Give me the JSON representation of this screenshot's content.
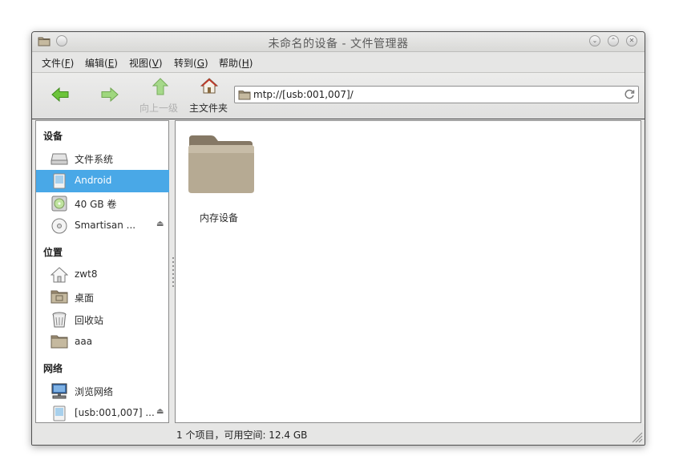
{
  "window": {
    "title": "未命名的设备 - 文件管理器",
    "controls": [
      "minimize-icon",
      "maximize-icon",
      "close-icon"
    ]
  },
  "menu": [
    {
      "label": "文件(",
      "key": "F",
      "tail": ")"
    },
    {
      "label": "编辑(",
      "key": "E",
      "tail": ")"
    },
    {
      "label": "视图(",
      "key": "V",
      "tail": ")"
    },
    {
      "label": "转到(",
      "key": "G",
      "tail": ")"
    },
    {
      "label": "帮助(",
      "key": "H",
      "tail": ")"
    }
  ],
  "toolbar": {
    "back_icon": "arrow-left-icon",
    "forward_icon": "arrow-right-icon",
    "up_label": "向上一级",
    "home_label": "主文件夹",
    "location": "mtp://[usb:001,007]/"
  },
  "sidebar": {
    "devices_header": "设备",
    "devices": [
      {
        "label": "文件系统",
        "icon": "drive-icon"
      },
      {
        "label": "Android",
        "icon": "phone-icon",
        "selected": true
      },
      {
        "label": "40 GB 卷",
        "icon": "disk-icon"
      },
      {
        "label": "Smartisan ...",
        "icon": "optical-disc-icon",
        "eject": true
      }
    ],
    "places_header": "位置",
    "places": [
      {
        "label": "zwt8",
        "icon": "home-icon"
      },
      {
        "label": "桌面",
        "icon": "desktop-folder-icon"
      },
      {
        "label": "回收站",
        "icon": "trash-icon"
      },
      {
        "label": "aaa",
        "icon": "folder-icon"
      }
    ],
    "network_header": "网络",
    "network": [
      {
        "label": "浏览网络",
        "icon": "network-icon"
      },
      {
        "label": "[usb:001,007] ...",
        "icon": "phone-icon",
        "eject": true
      }
    ]
  },
  "main": {
    "items": [
      {
        "label": "内存设备",
        "icon": "folder-icon"
      }
    ]
  },
  "status": {
    "text": "1 个项目，可用空间: 12.4 GB"
  },
  "colors": {
    "selection": "#49a8e7",
    "arrow_green": "#5cb82e",
    "folder": "#b0a48c"
  }
}
